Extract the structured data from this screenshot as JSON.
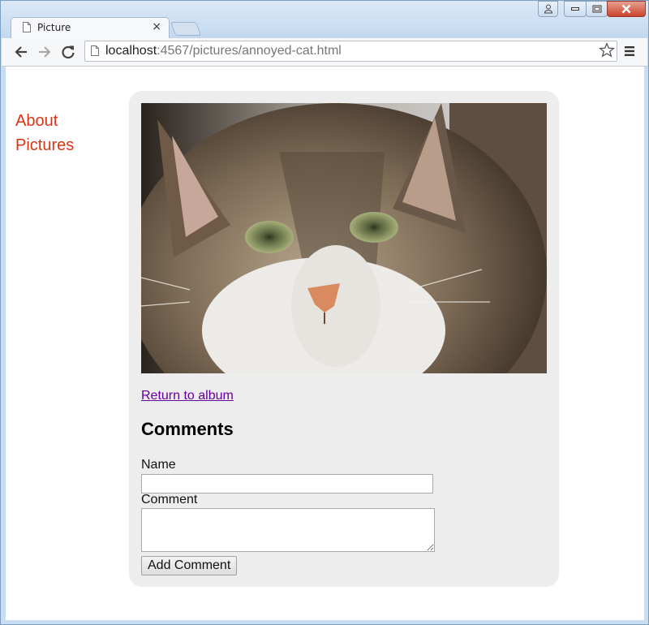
{
  "browser": {
    "tab_title": "Picture",
    "tab_close": "×",
    "url_host": "localhost",
    "url_rest": ":4567/pictures/annoyed-cat.html"
  },
  "nav": {
    "items": [
      {
        "label": "About"
      },
      {
        "label": "Pictures"
      }
    ]
  },
  "picture": {
    "image_icon": "cat-photo",
    "return_link": "Return to album"
  },
  "comments": {
    "heading": "Comments",
    "name_label": "Name",
    "name_value": "",
    "comment_label": "Comment",
    "comment_value": "",
    "submit_label": "Add Comment"
  },
  "colors": {
    "nav_link": "#dd3311",
    "visited_link": "#660099",
    "panel_bg": "#ededed"
  }
}
